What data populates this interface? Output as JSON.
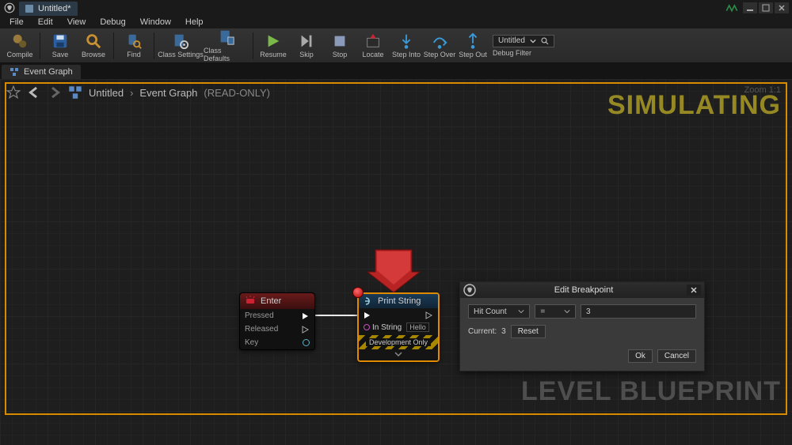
{
  "title_tab": "Untitled*",
  "menus": [
    "File",
    "Edit",
    "View",
    "Debug",
    "Window",
    "Help"
  ],
  "toolbar": {
    "compile": "Compile",
    "save": "Save",
    "browse": "Browse",
    "find": "Find",
    "class_settings": "Class Settings",
    "class_defaults": "Class Defaults",
    "resume": "Resume",
    "skip": "Skip",
    "stop": "Stop",
    "locate": "Locate",
    "step_into": "Step Into",
    "step_over": "Step Over",
    "step_out": "Step Out",
    "debug_filter_value": "Untitled",
    "debug_filter_label": "Debug Filter"
  },
  "panel_tab": "Event Graph",
  "breadcrumb": {
    "a": "Untitled",
    "b": "Event Graph",
    "ro": "(READ-ONLY)"
  },
  "zoom": "Zoom 1:1",
  "watermark_sim": "SIMULATING",
  "watermark_bp": "LEVEL BLUEPRINT",
  "node_enter": {
    "title": "Enter",
    "pressed": "Pressed",
    "released": "Released",
    "key": "Key"
  },
  "node_print": {
    "title": "Print String",
    "in_string_label": "In String",
    "in_string_value": "Hello",
    "dev_only": "Development Only"
  },
  "dialog": {
    "title": "Edit Breakpoint",
    "cond": "Hit Count",
    "op": "=",
    "value": "3",
    "current_label": "Current:",
    "current_value": "3",
    "reset": "Reset",
    "ok": "Ok",
    "cancel": "Cancel"
  }
}
